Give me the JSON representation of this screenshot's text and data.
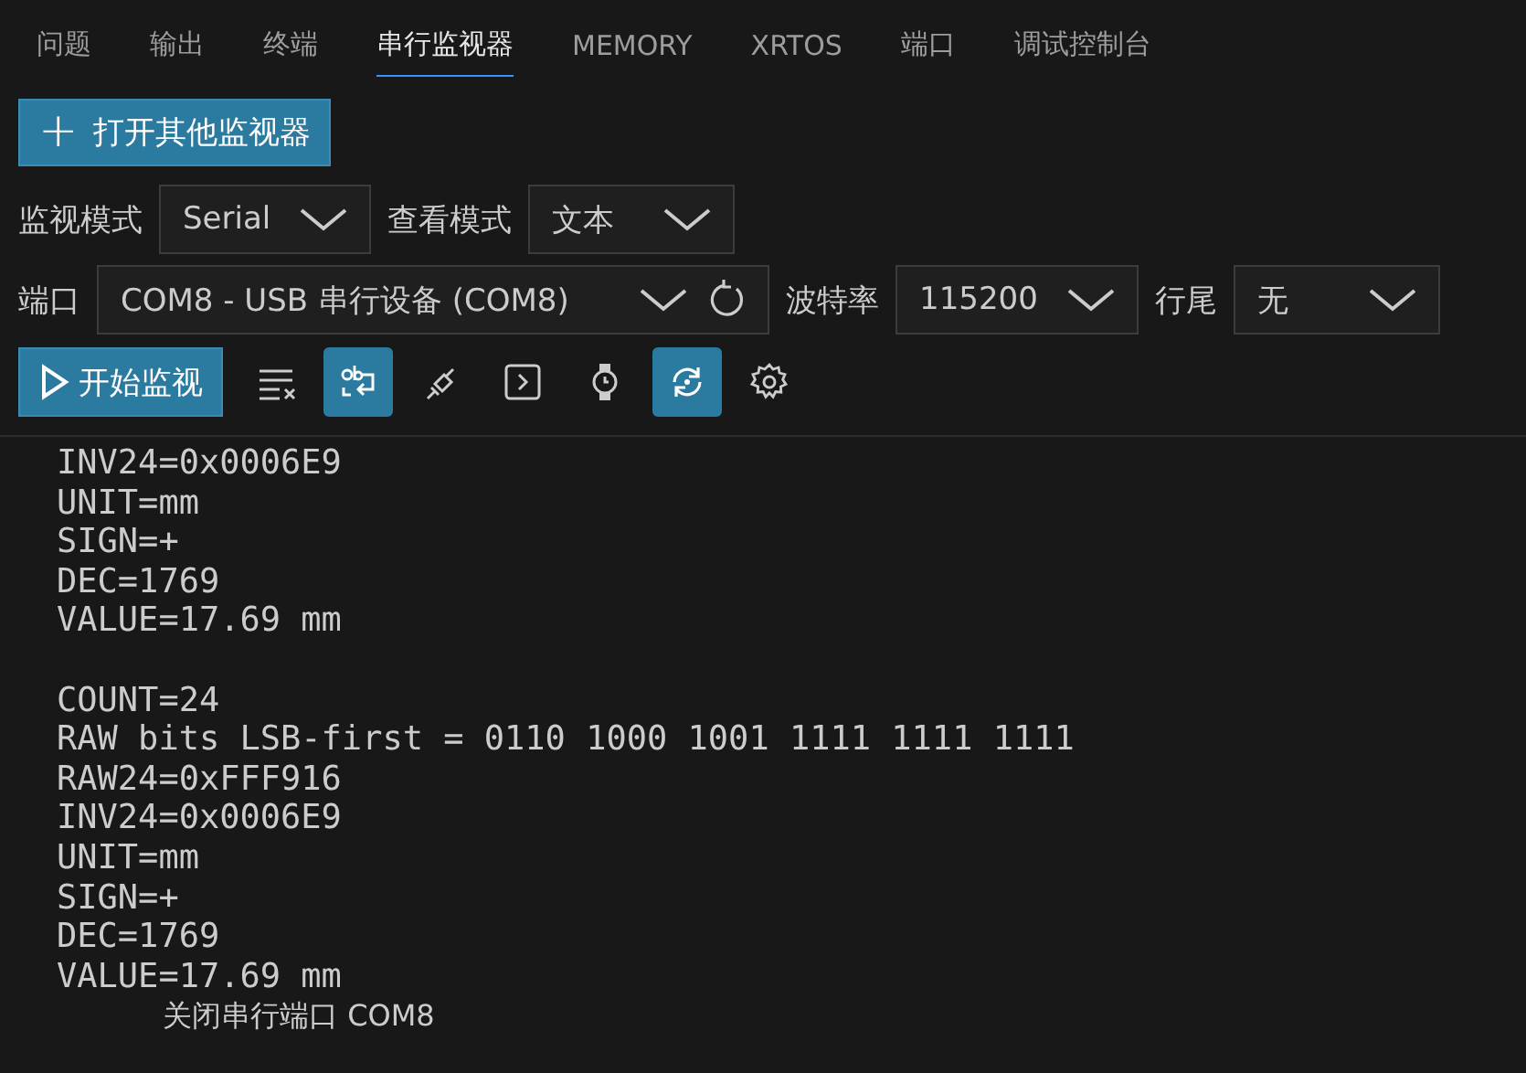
{
  "tabs": [
    {
      "label": "问题",
      "selected": false
    },
    {
      "label": "输出",
      "selected": false
    },
    {
      "label": "终端",
      "selected": false
    },
    {
      "label": "串行监视器",
      "selected": true
    },
    {
      "label": "MEMORY",
      "selected": false
    },
    {
      "label": "XRTOS",
      "selected": false
    },
    {
      "label": "端口",
      "selected": false
    },
    {
      "label": "调试控制台",
      "selected": false
    }
  ],
  "open_monitor_button": {
    "icon": "+",
    "label": "打开其他监视器"
  },
  "monitor_mode": {
    "label": "监视模式",
    "value": "Serial"
  },
  "view_mode": {
    "label": "查看模式",
    "value": "文本"
  },
  "port": {
    "label": "端口",
    "value": "COM8 - USB 串行设备 (COM8)"
  },
  "baud_rate": {
    "label": "波特率",
    "value": "115200"
  },
  "line_ending": {
    "label": "行尾",
    "value": "无"
  },
  "start_button": {
    "label": "开始监视"
  },
  "toolbar": [
    {
      "kind": "clear",
      "on": false
    },
    {
      "kind": "wrap",
      "on": true
    },
    {
      "kind": "plug",
      "on": false
    },
    {
      "kind": "terminal",
      "on": false
    },
    {
      "kind": "timestamp",
      "on": false
    },
    {
      "kind": "autoscroll",
      "on": true
    },
    {
      "kind": "settings",
      "on": false
    }
  ],
  "log": [
    {
      "kind": "data",
      "text": "INV24=0x0006E9"
    },
    {
      "kind": "data",
      "text": "UNIT=mm"
    },
    {
      "kind": "data",
      "text": "SIGN=+"
    },
    {
      "kind": "data",
      "text": "DEC=1769"
    },
    {
      "kind": "data",
      "text": "VALUE=17.69 mm"
    },
    {
      "kind": "blank"
    },
    {
      "kind": "data",
      "text": "COUNT=24"
    },
    {
      "kind": "data",
      "text": "RAW bits LSB-first = 0110 1000 1001 1111 1111 1111"
    },
    {
      "kind": "data",
      "text": "RAW24=0xFFF916"
    },
    {
      "kind": "data",
      "text": "INV24=0x0006E9"
    },
    {
      "kind": "data",
      "text": "UNIT=mm"
    },
    {
      "kind": "data",
      "text": "SIGN=+"
    },
    {
      "kind": "data",
      "text": "DEC=1769"
    },
    {
      "kind": "data",
      "text": "VALUE=17.69 mm"
    },
    {
      "kind": "system",
      "text": "关闭串行端口 COM8"
    }
  ]
}
